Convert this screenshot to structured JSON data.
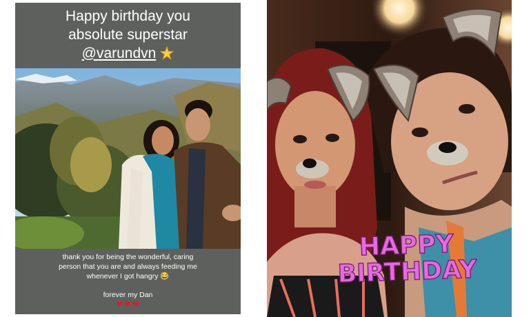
{
  "left_story": {
    "caption": {
      "line1": "Happy birthday you",
      "line2": "absolute superstar",
      "line3": "@varundvn"
    },
    "message": {
      "line1": "thank you for being the wonderful, caring",
      "line2": "person that you are and always feeding me",
      "line3": "whenever I got hangry 😂",
      "line4": "forever my Dan",
      "hearts": "❤❤❤"
    }
  },
  "right_story": {
    "sticker": {
      "line1": "HAPPY",
      "line2": "BIRTHDAY"
    }
  },
  "colors": {
    "story_background": "#5e605e",
    "sticker_fill": "#e56be0",
    "sticker_outline": "#7a1e78",
    "heart": "#d3202e"
  }
}
